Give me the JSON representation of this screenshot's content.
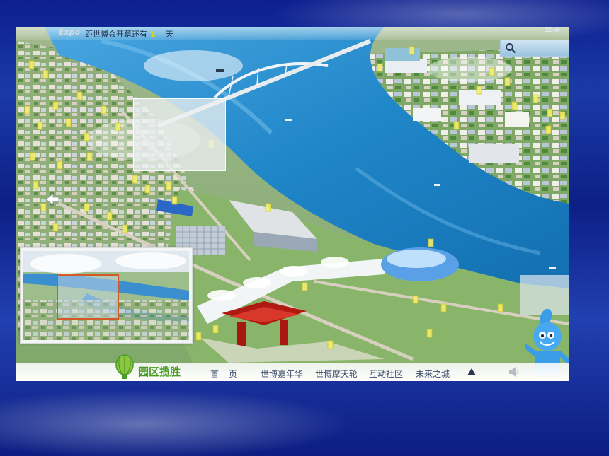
{
  "header": {
    "logo_text": "Expo",
    "countdown_prefix": "距世博会开幕还有",
    "countdown_days": "1",
    "countdown_unit": "天",
    "top_right_link": "登录"
  },
  "search": {
    "placeholder": ""
  },
  "footer": {
    "brand_title": "园区揽胜",
    "nav_items": {
      "home": "首页",
      "carnival": "世博嘉年华",
      "wheel": "世博摩天轮",
      "community": "互动社区",
      "future": "未来之城"
    }
  },
  "colors": {
    "river": "#2f8ccf",
    "brand_green": "#4a9a26",
    "pavilion_red": "#c9241a",
    "countdown_digit": "#e7d200"
  },
  "icons": {
    "search": "search-icon",
    "back": "back-arrow-icon",
    "up": "triangle-up-icon",
    "sound": "speaker-icon",
    "balloon": "balloon-icon"
  }
}
